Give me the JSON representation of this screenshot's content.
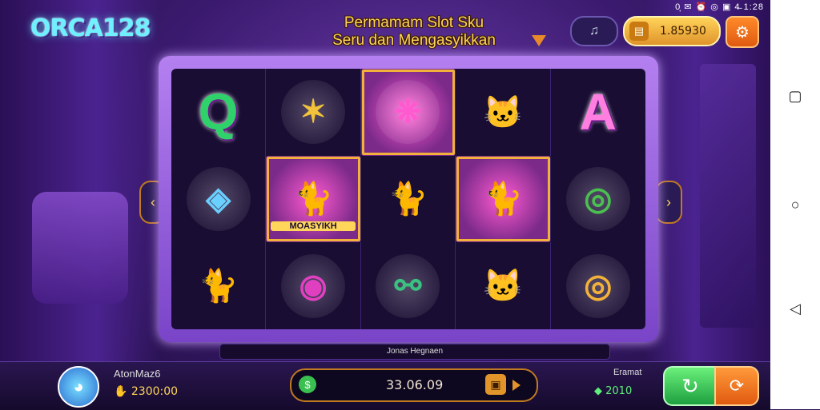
{
  "status_bar": {
    "text": "0̩̩ ✉ ⏰ ◎ ▣ 4̶ 1:28"
  },
  "logo": "ORCA128",
  "title": {
    "line1": "Permamam Slot Sku",
    "line2": "Seru dan Mengasyikkan"
  },
  "top_controls": {
    "sound_icon": "sound-toggle-icon",
    "balance": "1.85930",
    "settings_icon": "gear-icon"
  },
  "reels": [
    {
      "symbol": "Q",
      "kind": "letter-q",
      "color": "#2fd16a"
    },
    {
      "symbol": "✶",
      "kind": "star-gem",
      "color": "#f2c23a"
    },
    {
      "symbol": "❋",
      "kind": "pink-medallion",
      "color": "#ff5ad0",
      "highlight": true
    },
    {
      "symbol": "🐱",
      "kind": "white-cat"
    },
    {
      "symbol": "A",
      "kind": "letter-a",
      "color": "#ff7ee0"
    },
    {
      "symbol": "◈",
      "kind": "blue-shield",
      "color": "#6ad0ff"
    },
    {
      "symbol": "🐈",
      "kind": "orange-cat",
      "highlight": true,
      "label": "MOASYIKH"
    },
    {
      "symbol": "🐈",
      "kind": "red-cat"
    },
    {
      "symbol": "🐈",
      "kind": "green-cat",
      "highlight": true
    },
    {
      "symbol": "◎",
      "kind": "green-coin",
      "color": "#4ac050"
    },
    {
      "symbol": "🐈",
      "kind": "fox-cat"
    },
    {
      "symbol": "◉",
      "kind": "pink-eye-hat",
      "color": "#e040c0"
    },
    {
      "symbol": "⚯",
      "kind": "green-wand",
      "color": "#3ac080"
    },
    {
      "symbol": "🐱",
      "kind": "pink-cat"
    },
    {
      "symbol": "◎",
      "kind": "gold-coin",
      "color": "#f2b23a"
    }
  ],
  "caption": "Jonas Hegnaen",
  "player": {
    "name": "AtonMaz6",
    "coins": "2300:00",
    "avatar_icon": "avatar-icon"
  },
  "bet": {
    "value": "33.06.09",
    "icon": "coin-icon",
    "lock_icon": "lock-icon"
  },
  "extra": {
    "label": "Eramat",
    "value": "2010"
  },
  "buttons": {
    "spin_icon": "spin-icon",
    "auto_icon": "autoplay-icon"
  },
  "android_nav": [
    "recents-icon",
    "home-icon",
    "back-icon"
  ]
}
